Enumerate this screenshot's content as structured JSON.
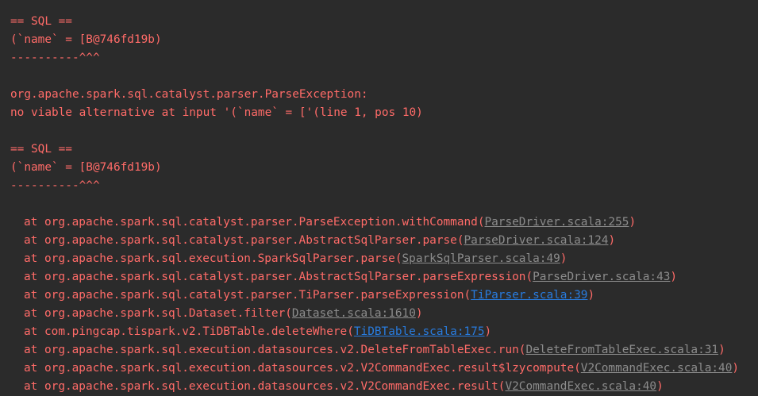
{
  "console": {
    "header_block_1": {
      "sql_marker": "== SQL ==",
      "sql_text": "(`name` = [B@746fd19b)",
      "pointer": "----------^^^"
    },
    "exception": {
      "class": "org.apache.spark.sql.catalyst.parser.ParseException:",
      "message": "no viable alternative at input '(`name` = ['(line 1, pos 10)"
    },
    "header_block_2": {
      "sql_marker": "== SQL ==",
      "sql_text": "(`name` = [B@746fd19b)",
      "pointer": "----------^^^"
    },
    "stack_trace": [
      {
        "prefix": "at org.apache.spark.sql.catalyst.parser.ParseException.withCommand(",
        "link": "ParseDriver.scala:255",
        "link_type": "library",
        "suffix": ")"
      },
      {
        "prefix": "at org.apache.spark.sql.catalyst.parser.AbstractSqlParser.parse(",
        "link": "ParseDriver.scala:124",
        "link_type": "library",
        "suffix": ")"
      },
      {
        "prefix": "at org.apache.spark.sql.execution.SparkSqlParser.parse(",
        "link": "SparkSqlParser.scala:49",
        "link_type": "library",
        "suffix": ")"
      },
      {
        "prefix": "at org.apache.spark.sql.catalyst.parser.AbstractSqlParser.parseExpression(",
        "link": "ParseDriver.scala:43",
        "link_type": "library",
        "suffix": ")"
      },
      {
        "prefix": "at org.apache.spark.sql.catalyst.parser.TiParser.parseExpression(",
        "link": "TiParser.scala:39",
        "link_type": "project",
        "suffix": ")"
      },
      {
        "prefix": "at org.apache.spark.sql.Dataset.filter(",
        "link": "Dataset.scala:1610",
        "link_type": "library",
        "suffix": ")"
      },
      {
        "prefix": "at com.pingcap.tispark.v2.TiDBTable.deleteWhere(",
        "link": "TiDBTable.scala:175",
        "link_type": "project",
        "suffix": ")"
      },
      {
        "prefix": "at org.apache.spark.sql.execution.datasources.v2.DeleteFromTableExec.run(",
        "link": "DeleteFromTableExec.scala:31",
        "link_type": "library",
        "suffix": ")"
      },
      {
        "prefix": "at org.apache.spark.sql.execution.datasources.v2.V2CommandExec.result$lzycompute(",
        "link": "V2CommandExec.scala:40",
        "link_type": "library",
        "suffix": ")"
      },
      {
        "prefix": "at org.apache.spark.sql.execution.datasources.v2.V2CommandExec.result(",
        "link": "V2CommandExec.scala:40",
        "link_type": "library",
        "suffix": ")"
      }
    ]
  },
  "colors": {
    "background": "#2b2b2b",
    "error_text": "#ff6b68",
    "library_link": "#8c8c8c",
    "project_link": "#287bde"
  }
}
